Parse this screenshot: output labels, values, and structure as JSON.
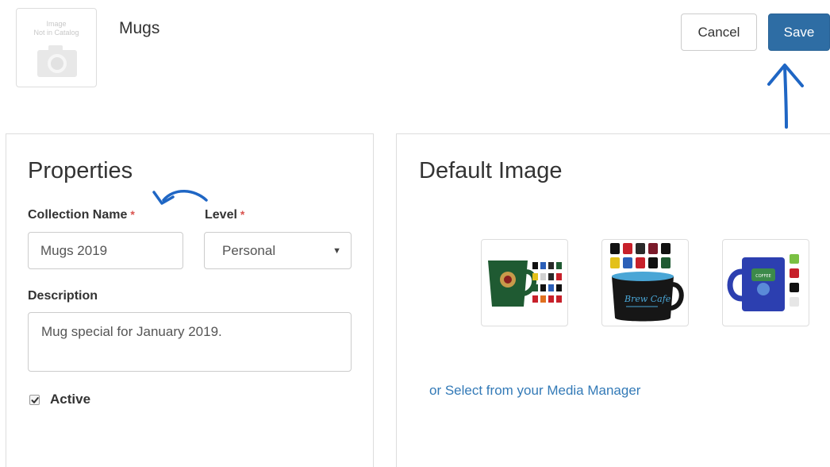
{
  "header": {
    "thumbnail_placeholder": "Image\nNot in Catalog",
    "collection_title": "Mugs",
    "cancel_label": "Cancel",
    "save_label": "Save"
  },
  "properties": {
    "heading": "Properties",
    "collection_name_label": "Collection Name",
    "required_marker": "*",
    "collection_name_value": "Mugs 2019",
    "level_label": "Level",
    "level_value": "Personal",
    "description_label": "Description",
    "description_value": "Mug special for January 2019.",
    "active_label": "Active",
    "active_checked": true
  },
  "default_image": {
    "heading": "Default Image",
    "options": [
      {
        "name": "green-mug-collection",
        "mug_color": "#1f5a32"
      },
      {
        "name": "black-bistro-mug-collection",
        "mug_color": "#1a1a1a"
      },
      {
        "name": "blue-carabiner-mug-collection",
        "mug_color": "#2c3fb0"
      }
    ],
    "media_manager_link": "or Select from your Media Manager"
  },
  "colors": {
    "primary": "#2e6da4",
    "link": "#337ab7",
    "required": "#d9534f",
    "annotation": "#1f66c4"
  }
}
